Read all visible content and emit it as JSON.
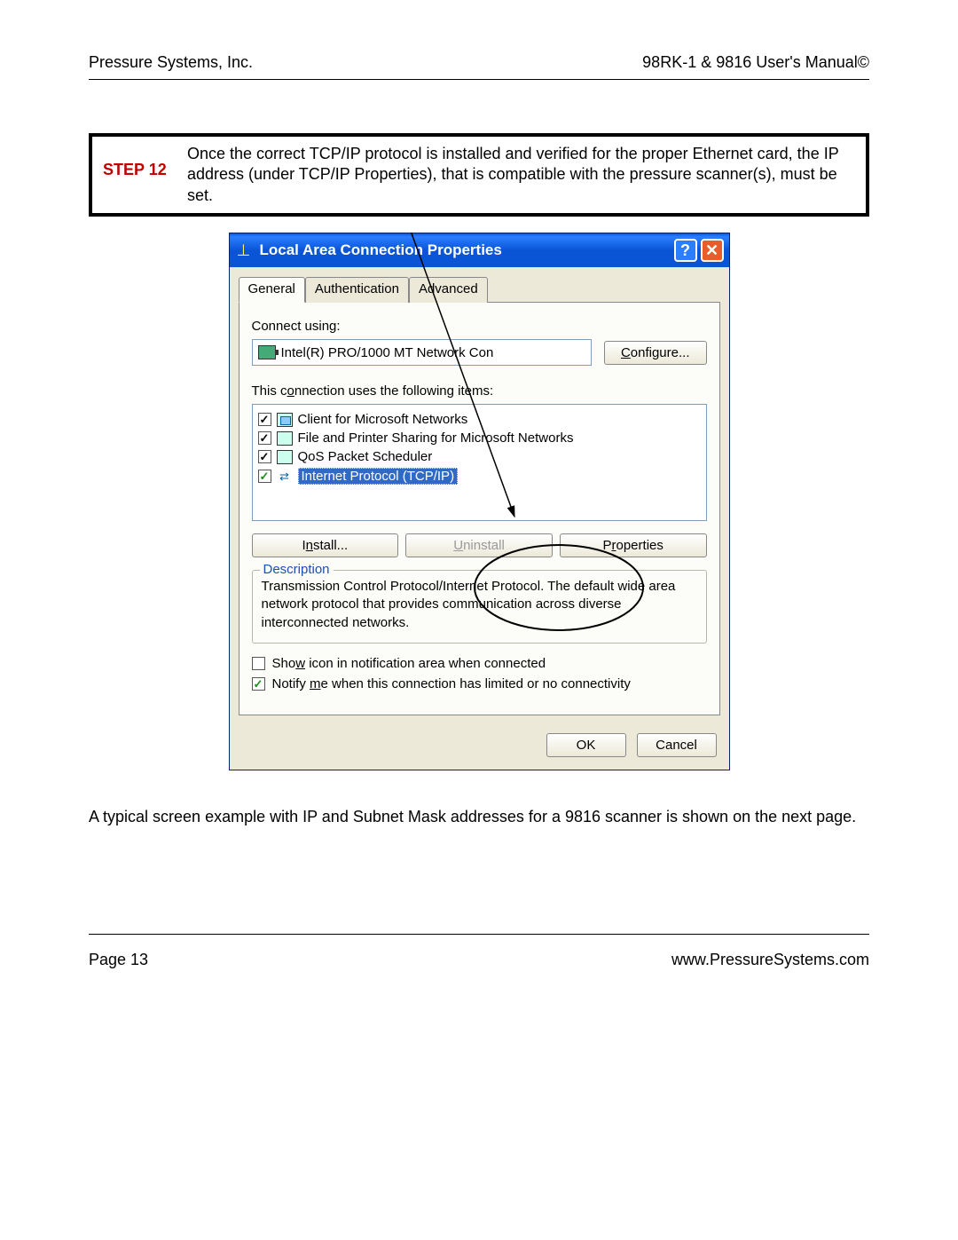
{
  "header": {
    "left": "Pressure Systems, Inc.",
    "right": "98RK-1 & 9816 User's Manual©"
  },
  "step": {
    "label": "STEP 12",
    "text": "Once the correct TCP/IP protocol is installed and verified for the proper Ethernet card, the IP address (under TCP/IP Properties), that is compatible with the pressure scanner(s), must be set."
  },
  "dialog": {
    "title": "Local Area Connection Properties",
    "tabs": [
      "General",
      "Authentication",
      "Advanced"
    ],
    "active_tab": 0,
    "connect_using_label": "Connect using:",
    "adapter": "Intel(R) PRO/1000 MT Network Con",
    "configure_btn": "Configure...",
    "items_label": "This connection uses the following items:",
    "items": [
      {
        "checked": true,
        "label": "Client for Microsoft Networks"
      },
      {
        "checked": true,
        "label": "File and Printer Sharing for Microsoft Networks"
      },
      {
        "checked": true,
        "label": "QoS Packet Scheduler"
      },
      {
        "checked": true,
        "label": "Internet Protocol (TCP/IP)",
        "selected": true
      }
    ],
    "install_btn": "Install...",
    "uninstall_btn": "Uninstall",
    "properties_btn": "Properties",
    "description_legend": "Description",
    "description_text": "Transmission Control Protocol/Internet Protocol. The default wide area network protocol that provides communication across diverse interconnected networks.",
    "show_icon_label": "Show icon in notification area when connected",
    "show_icon_checked": false,
    "notify_label": "Notify me when this connection has limited or no connectivity",
    "notify_checked": true,
    "ok_btn": "OK",
    "cancel_btn": "Cancel"
  },
  "caption": "A typical screen example with IP and Subnet Mask addresses for a 9816 scanner is shown on the next page.",
  "footer": {
    "left": "Page 13",
    "right": "www.PressureSystems.com"
  }
}
